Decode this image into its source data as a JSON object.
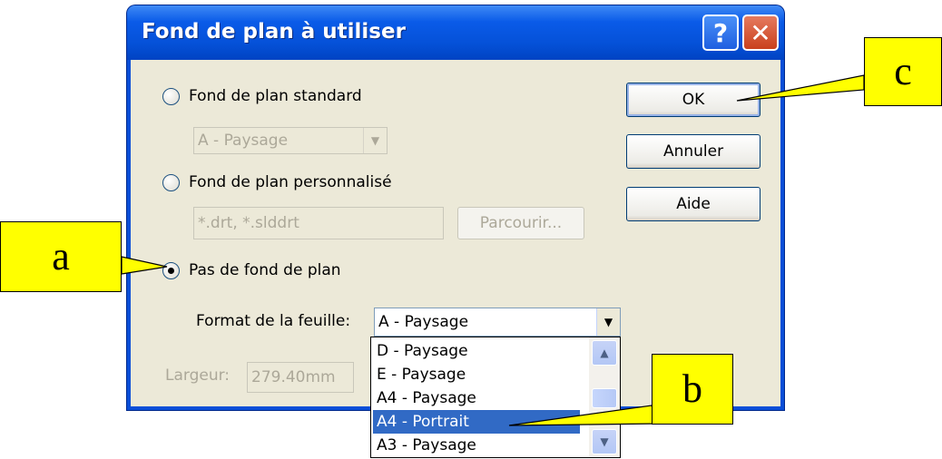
{
  "dialog": {
    "title": "Fond de plan à utiliser",
    "help_glyph": "?",
    "close_glyph": "✕"
  },
  "options": {
    "standard_label": "Fond de plan standard",
    "standard_combo_value": "A - Paysage",
    "custom_label": "Fond de plan personnalisé",
    "custom_path_value": "*.drt, *.slddrt",
    "browse_label": "Parcourir...",
    "none_label": "Pas de fond de plan",
    "selected": "none"
  },
  "sheet": {
    "format_label": "Format de la feuille:",
    "format_value": "A - Paysage",
    "width_label": "Largeur:",
    "width_value": "279.40mm",
    "list_items": [
      "D - Paysage",
      "E - Paysage",
      "A4 - Paysage",
      "A4 - Portrait",
      "A3 - Paysage"
    ],
    "highlighted_item": "A4 - Portrait"
  },
  "buttons": {
    "ok": "OK",
    "cancel": "Annuler",
    "help": "Aide"
  },
  "callouts": {
    "a": "a",
    "b": "b",
    "c": "c"
  },
  "colors": {
    "callout_fill": "#ffff00",
    "titlebar": "#0551d8",
    "selection": "#316ac5",
    "dialog_face": "#ece9d8"
  }
}
